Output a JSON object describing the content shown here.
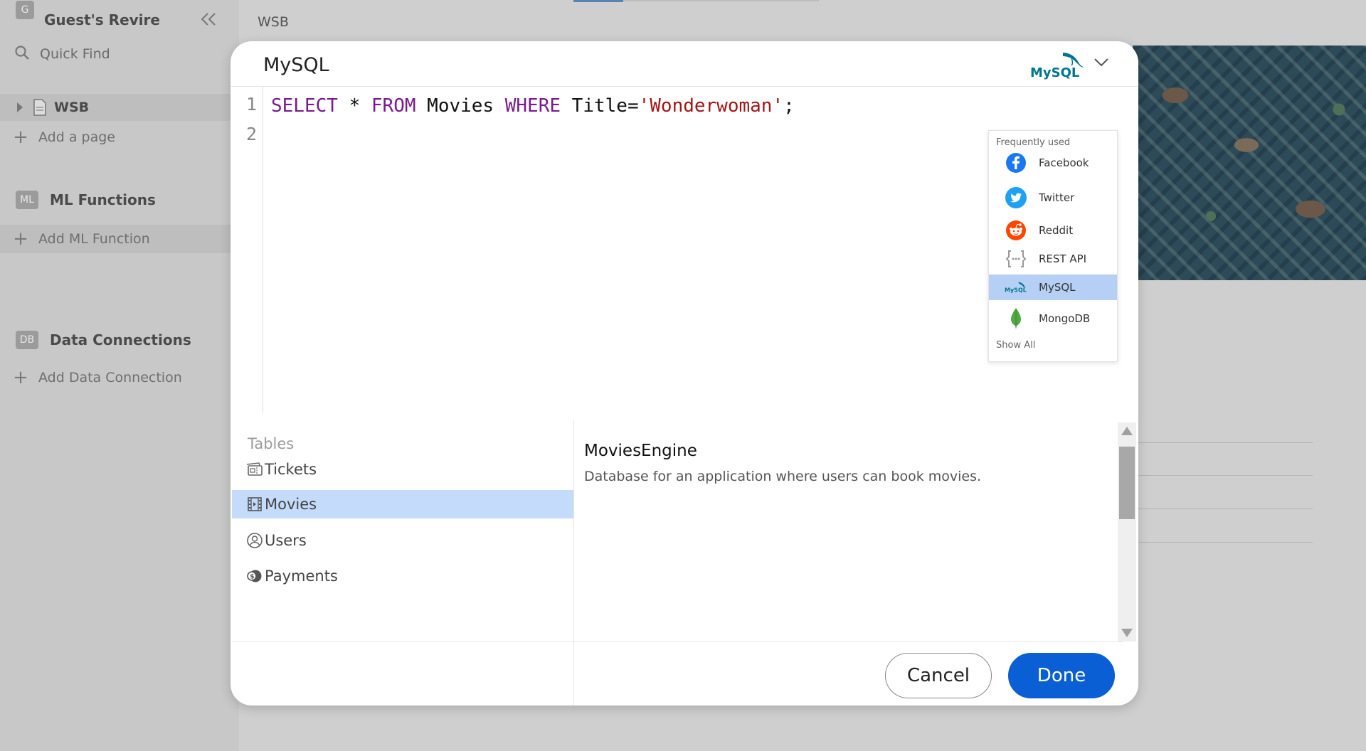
{
  "sidebar": {
    "workspace_badge": "G",
    "workspace_name": "Guest's Revire",
    "quick_find": "Quick Find",
    "pages": [
      {
        "label": "WSB"
      }
    ],
    "add_page": "Add a page",
    "ml_section": {
      "badge": "ML",
      "title": "ML Functions",
      "add_label": "Add ML Function"
    },
    "db_section": {
      "badge": "DB",
      "title": "Data Connections",
      "add_label": "Add Data Connection"
    }
  },
  "page": {
    "tab_title": "WSB"
  },
  "modal": {
    "title": "MySQL",
    "logo_text": "MySQL",
    "editor": {
      "line_numbers": [
        "1",
        "2"
      ],
      "tokens": {
        "select": "SELECT",
        "star": " * ",
        "from": "FROM",
        "table": " Movies ",
        "where": "WHERE",
        "condition": " Title=",
        "value": "'Wonderwoman'",
        "semicolon": ";"
      }
    },
    "source_dropdown": {
      "heading": "Frequently used",
      "items": [
        {
          "label": "Facebook",
          "icon": "facebook-icon",
          "color": "#1877f2"
        },
        {
          "label": "Twitter",
          "icon": "twitter-icon",
          "color": "#1da1f2"
        },
        {
          "label": "Reddit",
          "icon": "reddit-icon",
          "color": "#ff4500"
        },
        {
          "label": "REST API",
          "icon": "rest-api-icon",
          "color": "#9a9a9a"
        },
        {
          "label": "MySQL",
          "icon": "mysql-icon",
          "color": "#00758f",
          "selected": true
        },
        {
          "label": "MongoDB",
          "icon": "mongodb-icon",
          "color": "#4faa41"
        }
      ],
      "show_all": "Show All"
    },
    "tables": {
      "heading": "Tables",
      "items": [
        {
          "label": "Tickets",
          "icon": "ticket-icon"
        },
        {
          "label": "Movies",
          "icon": "film-icon",
          "selected": true
        },
        {
          "label": "Users",
          "icon": "user-icon"
        },
        {
          "label": "Payments",
          "icon": "payments-icon"
        }
      ]
    },
    "database": {
      "name": "MoviesEngine",
      "description": "Database for an application where users can book movies."
    },
    "buttons": {
      "cancel": "Cancel",
      "done": "Done"
    }
  },
  "colors": {
    "accent": "#0a5fd4",
    "selection": "#c4dbfb",
    "keyword": "#7a1a8e",
    "string": "#a31515"
  }
}
